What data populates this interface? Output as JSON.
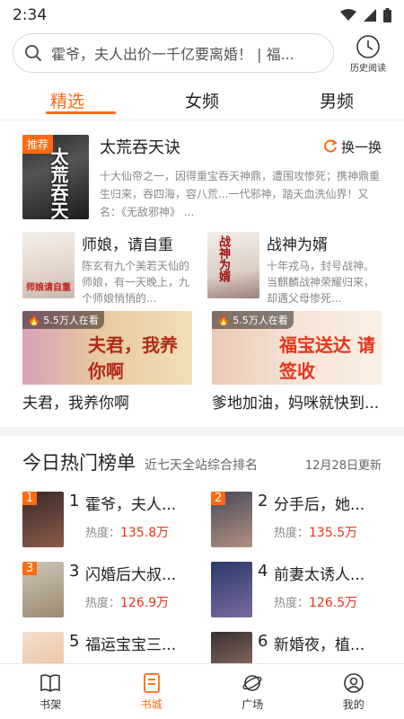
{
  "status": {
    "time": "2:34"
  },
  "search": {
    "placeholder": "霍爷，夫人出价一千亿要离婚！ | 福..."
  },
  "history": {
    "label": "历史阅读"
  },
  "tabs": [
    {
      "label": "精选"
    },
    {
      "label": "女频"
    },
    {
      "label": "男频"
    }
  ],
  "recommend": {
    "badge": "推荐",
    "cover_text": "太荒吞天",
    "title": "太荒吞天诀",
    "swap_label": "换一换",
    "desc": "十大仙帝之一，因得重宝吞天神鼎，遭围攻惨死；携神鼎重生归来，吞四海，容八荒...一代邪神，踏天血洗仙界！又名：《无敌邪神》 ..."
  },
  "pair": [
    {
      "title": "师娘，请自重",
      "cover_text": "师娘请自重",
      "desc": "陈玄有九个美若天仙的师娘，有一天晚上，九个师娘悄悄的..."
    },
    {
      "title": "战神为婿",
      "cover_text": "战神为婿",
      "desc": "十年戎马，封号战神。当麒麟战神荣耀归来，却遇父母惨死..."
    }
  ],
  "banners": [
    {
      "watching": "5.5万人在看",
      "art_text": "夫君，我养你啊",
      "title": "夫君，我养你啊"
    },
    {
      "watching": "5.5万人在看",
      "art_text": "福宝送达 请签收",
      "title": "爹地加油，妈咪就快到..."
    }
  ],
  "hot": {
    "title": "今日热门榜单",
    "subtitle": "近七天全站综合排名",
    "date": "12月28日更新",
    "heat_label": "热度：",
    "items": [
      {
        "rank": "1",
        "name": "霍爷，夫人...",
        "heat": "135.8万"
      },
      {
        "rank": "2",
        "name": "分手后，她...",
        "heat": "135.5万"
      },
      {
        "rank": "3",
        "name": "闪婚后大叔...",
        "heat": "126.9万"
      },
      {
        "rank": "4",
        "name": "前妻太诱人...",
        "heat": "126.5万"
      },
      {
        "rank": "5",
        "name": "福运宝宝三...",
        "heat": ""
      },
      {
        "rank": "6",
        "name": "新婚夜，植...",
        "heat": ""
      }
    ]
  },
  "nav": [
    {
      "label": "书架",
      "icon": "book-open-icon"
    },
    {
      "label": "书城",
      "icon": "store-book-icon"
    },
    {
      "label": "广场",
      "icon": "planet-icon"
    },
    {
      "label": "我的",
      "icon": "user-icon"
    }
  ],
  "colors": {
    "accent": "#ff6a12",
    "heat": "#e8341c"
  }
}
